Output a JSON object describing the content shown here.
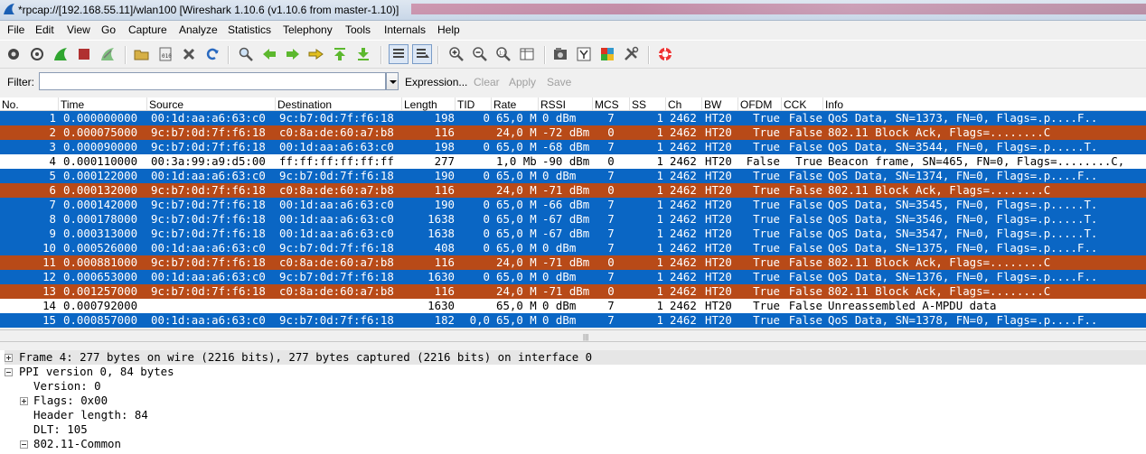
{
  "window": {
    "title": "*rpcap://[192.168.55.11]/wlan100   [Wireshark 1.10.6  (v1.10.6 from master-1.10)]"
  },
  "menu": [
    "File",
    "Edit",
    "View",
    "Go",
    "Capture",
    "Analyze",
    "Statistics",
    "Telephony",
    "Tools",
    "Internals",
    "Help"
  ],
  "toolbar": {
    "icons": [
      "interfaces-icon",
      "options-icon",
      "start-capture-icon",
      "stop-capture-icon",
      "restart-capture-icon",
      "open-file-icon",
      "save-file-icon",
      "close-file-icon",
      "reload-icon",
      "find-icon",
      "go-back-icon",
      "go-forward-icon",
      "go-to-packet-icon",
      "go-first-icon",
      "go-last-icon",
      "colorize-icon",
      "auto-scroll-icon",
      "zoom-in-icon",
      "zoom-out-icon",
      "normal-size-icon",
      "resize-columns-icon",
      "capture-filters-icon",
      "display-filters-icon",
      "coloring-rules-icon",
      "preferences-icon",
      "help-icon"
    ]
  },
  "filter": {
    "label": "Filter:",
    "value": "",
    "expression": "Expression...",
    "clear": "Clear",
    "apply": "Apply",
    "save": "Save"
  },
  "columns": [
    "No.",
    "Time",
    "Source",
    "Destination",
    "Length",
    "TID",
    "Rate",
    "RSSI",
    "MCS",
    "SS",
    "Ch",
    "BW",
    "OFDM",
    "CCK",
    "Info"
  ],
  "colors": {
    "blue_row": "#0a66c4",
    "orange_row": "#b84a18",
    "selected_row": "#ffffff"
  },
  "packets": [
    {
      "no": "1",
      "time": "0.000000000",
      "src": "00:1d:aa:a6:63:c0",
      "dst": "9c:b7:0d:7f:f6:18",
      "len": "198",
      "tid": "0",
      "rate": "65,0 M",
      "rssi": "0 dBm",
      "mcs": "7",
      "ss": "1",
      "ch": "2462",
      "bw": "HT20",
      "ofdm": "True",
      "cck": "False",
      "info": "QoS Data, SN=1373, FN=0, Flags=.p....F..",
      "color": "blue"
    },
    {
      "no": "2",
      "time": "0.000075000",
      "src": "9c:b7:0d:7f:f6:18",
      "dst": "c0:8a:de:60:a7:b8",
      "len": "116",
      "tid": "",
      "rate": "24,0 M",
      "rssi": "-72 dBm",
      "mcs": "0",
      "ss": "1",
      "ch": "2462",
      "bw": "HT20",
      "ofdm": "True",
      "cck": "False",
      "info": "802.11 Block Ack, Flags=........C",
      "color": "orange"
    },
    {
      "no": "3",
      "time": "0.000090000",
      "src": "9c:b7:0d:7f:f6:18",
      "dst": "00:1d:aa:a6:63:c0",
      "len": "198",
      "tid": "0",
      "rate": "65,0 M",
      "rssi": "-68 dBm",
      "mcs": "7",
      "ss": "1",
      "ch": "2462",
      "bw": "HT20",
      "ofdm": "True",
      "cck": "False",
      "info": "QoS Data, SN=3544, FN=0, Flags=.p.....T.",
      "color": "blue"
    },
    {
      "no": "4",
      "time": "0.000110000",
      "src": "00:3a:99:a9:d5:00",
      "dst": "ff:ff:ff:ff:ff:ff",
      "len": "277",
      "tid": "",
      "rate": "1,0 Mb",
      "rssi": "-90 dBm",
      "mcs": "0",
      "ss": "1",
      "ch": "2462",
      "bw": "HT20",
      "ofdm": "False",
      "cck": "True",
      "info": "Beacon frame, SN=465, FN=0, Flags=........C,",
      "color": "white"
    },
    {
      "no": "5",
      "time": "0.000122000",
      "src": "00:1d:aa:a6:63:c0",
      "dst": "9c:b7:0d:7f:f6:18",
      "len": "190",
      "tid": "0",
      "rate": "65,0 M",
      "rssi": "0 dBm",
      "mcs": "7",
      "ss": "1",
      "ch": "2462",
      "bw": "HT20",
      "ofdm": "True",
      "cck": "False",
      "info": "QoS Data, SN=1374, FN=0, Flags=.p....F..",
      "color": "blue"
    },
    {
      "no": "6",
      "time": "0.000132000",
      "src": "9c:b7:0d:7f:f6:18",
      "dst": "c0:8a:de:60:a7:b8",
      "len": "116",
      "tid": "",
      "rate": "24,0 M",
      "rssi": "-71 dBm",
      "mcs": "0",
      "ss": "1",
      "ch": "2462",
      "bw": "HT20",
      "ofdm": "True",
      "cck": "False",
      "info": "802.11 Block Ack, Flags=........C",
      "color": "orange"
    },
    {
      "no": "7",
      "time": "0.000142000",
      "src": "9c:b7:0d:7f:f6:18",
      "dst": "00:1d:aa:a6:63:c0",
      "len": "190",
      "tid": "0",
      "rate": "65,0 M",
      "rssi": "-66 dBm",
      "mcs": "7",
      "ss": "1",
      "ch": "2462",
      "bw": "HT20",
      "ofdm": "True",
      "cck": "False",
      "info": "QoS Data, SN=3545, FN=0, Flags=.p.....T.",
      "color": "blue"
    },
    {
      "no": "8",
      "time": "0.000178000",
      "src": "9c:b7:0d:7f:f6:18",
      "dst": "00:1d:aa:a6:63:c0",
      "len": "1638",
      "tid": "0",
      "rate": "65,0 M",
      "rssi": "-67 dBm",
      "mcs": "7",
      "ss": "1",
      "ch": "2462",
      "bw": "HT20",
      "ofdm": "True",
      "cck": "False",
      "info": "QoS Data, SN=3546, FN=0, Flags=.p.....T.",
      "color": "blue"
    },
    {
      "no": "9",
      "time": "0.000313000",
      "src": "9c:b7:0d:7f:f6:18",
      "dst": "00:1d:aa:a6:63:c0",
      "len": "1638",
      "tid": "0",
      "rate": "65,0 M",
      "rssi": "-67 dBm",
      "mcs": "7",
      "ss": "1",
      "ch": "2462",
      "bw": "HT20",
      "ofdm": "True",
      "cck": "False",
      "info": "QoS Data, SN=3547, FN=0, Flags=.p.....T.",
      "color": "blue"
    },
    {
      "no": "10",
      "time": "0.000526000",
      "src": "00:1d:aa:a6:63:c0",
      "dst": "9c:b7:0d:7f:f6:18",
      "len": "408",
      "tid": "0",
      "rate": "65,0 M",
      "rssi": "0 dBm",
      "mcs": "7",
      "ss": "1",
      "ch": "2462",
      "bw": "HT20",
      "ofdm": "True",
      "cck": "False",
      "info": "QoS Data, SN=1375, FN=0, Flags=.p....F..",
      "color": "blue"
    },
    {
      "no": "11",
      "time": "0.000881000",
      "src": "9c:b7:0d:7f:f6:18",
      "dst": "c0:8a:de:60:a7:b8",
      "len": "116",
      "tid": "",
      "rate": "24,0 M",
      "rssi": "-71 dBm",
      "mcs": "0",
      "ss": "1",
      "ch": "2462",
      "bw": "HT20",
      "ofdm": "True",
      "cck": "False",
      "info": "802.11 Block Ack, Flags=........C",
      "color": "orange"
    },
    {
      "no": "12",
      "time": "0.000653000",
      "src": "00:1d:aa:a6:63:c0",
      "dst": "9c:b7:0d:7f:f6:18",
      "len": "1630",
      "tid": "0",
      "rate": "65,0 M",
      "rssi": "0 dBm",
      "mcs": "7",
      "ss": "1",
      "ch": "2462",
      "bw": "HT20",
      "ofdm": "True",
      "cck": "False",
      "info": "QoS Data, SN=1376, FN=0, Flags=.p....F..",
      "color": "blue"
    },
    {
      "no": "13",
      "time": "0.001257000",
      "src": "9c:b7:0d:7f:f6:18",
      "dst": "c0:8a:de:60:a7:b8",
      "len": "116",
      "tid": "",
      "rate": "24,0 M",
      "rssi": "-71 dBm",
      "mcs": "0",
      "ss": "1",
      "ch": "2462",
      "bw": "HT20",
      "ofdm": "True",
      "cck": "False",
      "info": "802.11 Block Ack, Flags=........C",
      "color": "orange"
    },
    {
      "no": "14",
      "time": "0.000792000",
      "src": "",
      "dst": "",
      "len": "1630",
      "tid": "",
      "rate": "65,0 M",
      "rssi": "0 dBm",
      "mcs": "7",
      "ss": "1",
      "ch": "2462",
      "bw": "HT20",
      "ofdm": "True",
      "cck": "False",
      "info": "Unreassembled A-MPDU data",
      "color": "white"
    },
    {
      "no": "15",
      "time": "0.000857000",
      "src": "00:1d:aa:a6:63:c0",
      "dst": "9c:b7:0d:7f:f6:18",
      "len": "182",
      "tid": "0,0",
      "rate": "65,0 M",
      "rssi": "0 dBm",
      "mcs": "7",
      "ss": "1",
      "ch": "2462",
      "bw": "HT20",
      "ofdm": "True",
      "cck": "False",
      "info": "QoS Data, SN=1378, FN=0, Flags=.p....F..",
      "color": "blue"
    }
  ],
  "splitter_grip": "|||",
  "details": [
    {
      "text": "Frame 4: 277 bytes on wire (2216 bits), 277 bytes captured (2216 bits) on interface 0",
      "expander": "plus",
      "indent": 0
    },
    {
      "text": "PPI version 0, 84 bytes",
      "expander": "minus",
      "indent": 0
    },
    {
      "text": "Version: 0",
      "expander": "",
      "indent": 1
    },
    {
      "text": "Flags: 0x00",
      "expander": "plus",
      "indent": 1
    },
    {
      "text": "Header length: 84",
      "expander": "",
      "indent": 1
    },
    {
      "text": "DLT: 105",
      "expander": "",
      "indent": 1
    },
    {
      "text": "802.11-Common",
      "expander": "minus",
      "indent": 1
    }
  ]
}
